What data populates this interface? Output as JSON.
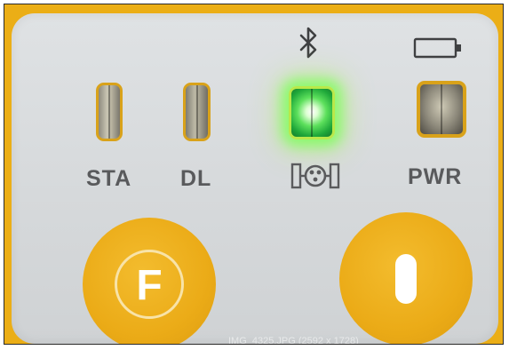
{
  "indicators": {
    "sta_label": "STA",
    "dl_label": "DL",
    "pwr_label": "PWR",
    "bluetooth_led_state": "on",
    "bluetooth_led_color": "#4fe04a"
  },
  "icons": {
    "bluetooth": "bluetooth-icon",
    "battery": "battery-icon",
    "satellite": "satellite-icon"
  },
  "buttons": {
    "function_letter": "F",
    "power_symbol": "power-icon"
  },
  "colors": {
    "body_accent": "#ebae16",
    "panel": "#dadddf",
    "label_text": "#595a5c"
  },
  "watermark": {
    "text": "IMG_4325.JPG (2592 x 1728)"
  }
}
